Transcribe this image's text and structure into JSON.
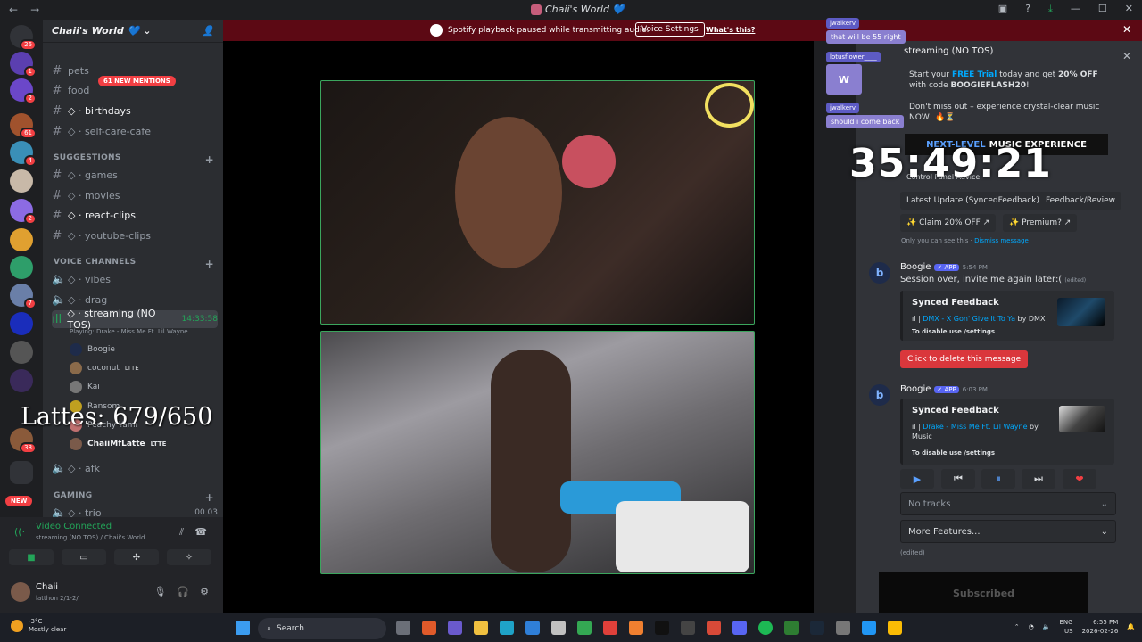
{
  "window": {
    "title": "Chaii's World 💙",
    "back": "←",
    "forward": "→"
  },
  "servers": {
    "badges": [
      "26",
      "1",
      "2",
      "61",
      "4",
      "2",
      "7",
      "38"
    ],
    "new_label": "NEW"
  },
  "server_header": {
    "name": "Chaii's World 💙"
  },
  "channels": {
    "mentions_badge": "61 NEW MENTIONS",
    "items": [
      {
        "name": "pets"
      },
      {
        "name": "food"
      },
      {
        "name": "◇ · birthdays"
      },
      {
        "name": "◇ · self-care-cafe"
      }
    ],
    "suggestions_label": "SUGGESTIONS",
    "suggestions": [
      {
        "name": "◇ · games"
      },
      {
        "name": "◇ · movies"
      },
      {
        "name": "◇ · react-clips"
      },
      {
        "name": "◇ · youtube-clips"
      }
    ],
    "voice_label": "VOICE CHANNELS",
    "voice": [
      {
        "name": "◇ · vibes"
      },
      {
        "name": "◇ · drag"
      },
      {
        "name": "◇ · streaming (NO TOS)",
        "timer": "14:33:58"
      }
    ],
    "playing": "Playing: Drake - Miss Me Ft. Lil Wayne",
    "voice_users": [
      {
        "name": "Boogie",
        "tag": ""
      },
      {
        "name": "coconut",
        "tag": "LTTE"
      },
      {
        "name": "Kai",
        "tag": ""
      },
      {
        "name": "Ransom",
        "tag": ""
      },
      {
        "name": "Peachy Yami",
        "tag": ""
      },
      {
        "name": "ChaiiMfLatte",
        "tag": "LTTE"
      }
    ],
    "afk": "◇ · afk",
    "gaming_label": "GAMING",
    "trio": "◇ · trio",
    "trio_counts": "00  03"
  },
  "lattes_overlay": "Lattes: 679/650",
  "voice_panel": {
    "status": "Video Connected",
    "sub": "streaming (NO TOS) / Chaii's World..."
  },
  "user_panel": {
    "name": "Chaii",
    "status": "latthon 2/1-2/"
  },
  "banner": {
    "message": "Spotify playback paused while transmitting audio.",
    "button": "Voice Settings",
    "link": "What's this?"
  },
  "side_panel": {
    "title": "streaming (NO TOS)",
    "chat_overlay": [
      {
        "user": "jwalkerv",
        "text": "that will be 55 right"
      },
      {
        "user": "lotusflower____",
        "text": ""
      },
      {
        "user": "jwalkerv",
        "text": "should i come back"
      }
    ],
    "timer": "35:49:21",
    "promo_line1_a": "Start your ",
    "promo_free": "FREE Trial",
    "promo_line1_b": " today and get ",
    "promo_off": "20% OFF",
    "promo_line1_c": " with code ",
    "promo_code": "BOOGIEFLASH20",
    "promo_line2": "Don't miss out – experience crystal-clear music NOW! 🔥⏳",
    "nextlevel_a": "NEXT-LEVEL",
    "nextlevel_b": "MUSIC EXPERIENCE",
    "control_panel": "Control Panel Advice:",
    "pills": [
      "Latest Update (SyncedFeedback)",
      "Feedback/Review",
      "✨ Claim 20% OFF ↗",
      "✨ Premium? ↗"
    ],
    "only_you": "Only you can see this · ",
    "dismiss": "Dismiss message",
    "msg1": {
      "name": "Boogie",
      "app": "✓ APP",
      "time": "5:54 PM",
      "text": "Session over, invite me again later:(",
      "edited": "(edited)",
      "embed_title": "Synced Feedback",
      "song": "DMX - X Gon' Give It To Ya",
      "by": " by DMX",
      "disable": "To disable use /settings",
      "delete_btn": "Click to delete this message"
    },
    "msg2": {
      "name": "Boogie",
      "app": "✓ APP",
      "time": "6:03 PM",
      "embed_title": "Synced Feedback",
      "song": "Drake - Miss Me Ft. Lil Wayne",
      "by": " by Music",
      "disable": "To disable use /settings"
    },
    "controls": [
      "▶",
      "⏮",
      "⏸",
      "⏭",
      "❤"
    ],
    "no_tracks": "No tracks",
    "more_features": "More Features...",
    "edited_note": "(edited)",
    "subscribed": "Subscribed"
  },
  "taskbar": {
    "temp": "-3°C",
    "weather": "Mostly clear",
    "search": "Search",
    "lang": "ENG",
    "region": "US",
    "time": "6:55 PM",
    "date": "2026-02-26"
  }
}
